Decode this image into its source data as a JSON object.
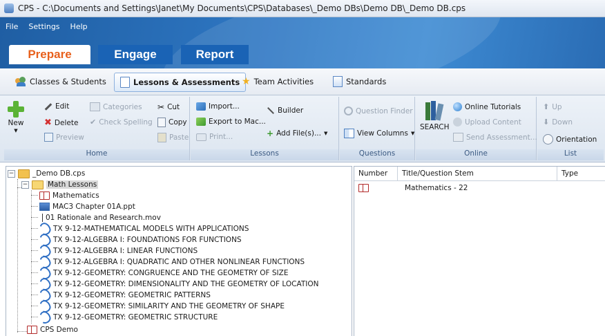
{
  "window": {
    "title": "CPS - C:\\Documents and Settings\\Janet\\My Documents\\CPS\\Databases\\_Demo DBs\\Demo DB\\_Demo DB.cps"
  },
  "menu": [
    "File",
    "Settings",
    "Help"
  ],
  "mode_tabs": [
    "Prepare",
    "Engage",
    "Report"
  ],
  "sub_tabs": [
    "Classes & Students",
    "Lessons & Assessments",
    "Team Activities",
    "Standards"
  ],
  "ribbon": {
    "home": {
      "label": "Home",
      "new": "New",
      "edit": "Edit",
      "delete": "Delete",
      "preview": "Preview",
      "categories": "Categories",
      "check_spelling": "Check Spelling",
      "cut": "Cut",
      "copy": "Copy",
      "paste": "Paste"
    },
    "lessons": {
      "label": "Lessons",
      "import": "Import...",
      "export": "Export to Mac...",
      "print": "Print...",
      "builder": "Builder",
      "add_files": "Add File(s)..."
    },
    "questions": {
      "label": "Questions",
      "finder": "Question Finder",
      "view_columns": "View Columns"
    },
    "online": {
      "label": "Online",
      "search": "SEARCH",
      "tutorials": "Online Tutorials",
      "upload": "Upload Content",
      "send": "Send Assessment..."
    },
    "list": {
      "label": "List",
      "up": "Up",
      "down": "Down",
      "orientation": "Orientation"
    }
  },
  "tree": {
    "root": "_Demo DB.cps",
    "folder": "Math Lessons",
    "items": [
      "Mathematics",
      "MAC3 Chapter 01A.ppt",
      "01 Rationale and Research.mov",
      "TX 9-12-MATHEMATICAL MODELS WITH APPLICATIONS",
      "TX 9-12-ALGEBRA I: FOUNDATIONS FOR FUNCTIONS",
      "TX 9-12-ALGEBRA I: LINEAR FUNCTIONS",
      "TX 9-12-ALGEBRA I: QUADRATIC AND OTHER NONLINEAR FUNCTIONS",
      "TX 9-12-GEOMETRY: CONGRUENCE AND THE GEOMETRY OF SIZE",
      "TX 9-12-GEOMETRY: DIMENSIONALITY AND THE GEOMETRY OF LOCATION",
      "TX 9-12-GEOMETRY: GEOMETRIC PATTERNS",
      "TX 9-12-GEOMETRY: SIMILARITY AND THE GEOMETRY OF SHAPE",
      "TX 9-12-GEOMETRY: GEOMETRIC STRUCTURE"
    ],
    "last": "CPS Demo"
  },
  "list": {
    "columns": [
      "Number",
      "Title/Question Stem",
      "Type"
    ],
    "rows": [
      {
        "title": "Mathematics - 22"
      }
    ]
  }
}
